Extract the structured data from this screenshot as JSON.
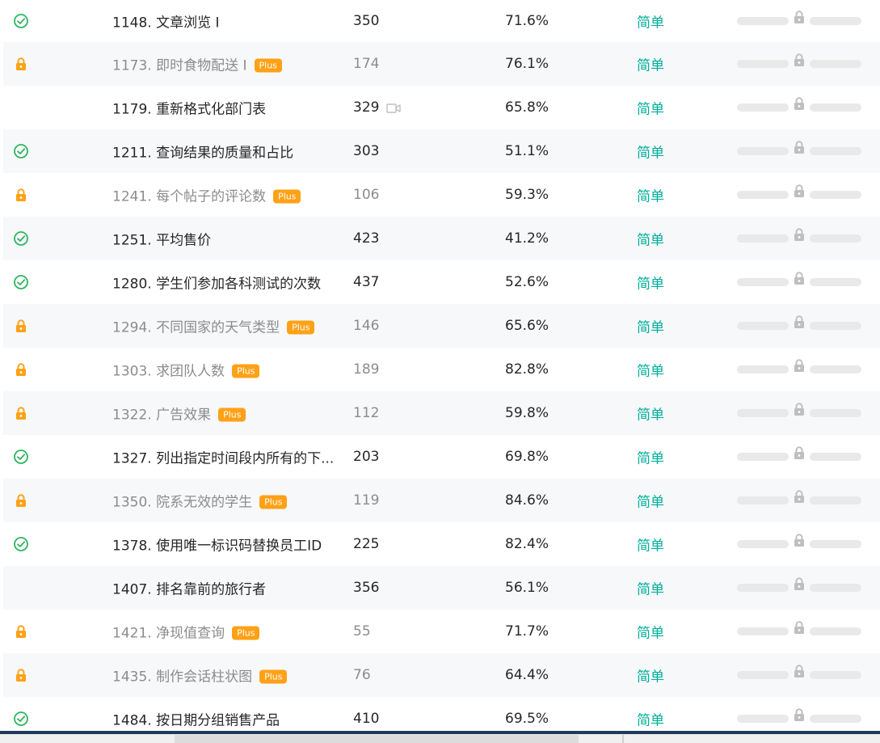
{
  "rows": [
    {
      "title": "1148. 文章浏览 I",
      "solutions": "350",
      "rate": "71.6%",
      "difficulty": "简单",
      "status": "solved",
      "plus": false,
      "video": false
    },
    {
      "title": "1173. 即时食物配送 I",
      "solutions": "174",
      "rate": "76.1%",
      "difficulty": "简单",
      "status": "locked",
      "plus": true,
      "video": false
    },
    {
      "title": "1179. 重新格式化部门表",
      "solutions": "329",
      "rate": "65.8%",
      "difficulty": "简单",
      "status": "none",
      "plus": false,
      "video": true
    },
    {
      "title": "1211. 查询结果的质量和占比",
      "solutions": "303",
      "rate": "51.1%",
      "difficulty": "简单",
      "status": "solved",
      "plus": false,
      "video": false
    },
    {
      "title": "1241. 每个帖子的评论数",
      "solutions": "106",
      "rate": "59.3%",
      "difficulty": "简单",
      "status": "locked",
      "plus": true,
      "video": false
    },
    {
      "title": "1251. 平均售价",
      "solutions": "423",
      "rate": "41.2%",
      "difficulty": "简单",
      "status": "solved",
      "plus": false,
      "video": false
    },
    {
      "title": "1280. 学生们参加各科测试的次数",
      "solutions": "437",
      "rate": "52.6%",
      "difficulty": "简单",
      "status": "solved",
      "plus": false,
      "video": false
    },
    {
      "title": "1294. 不同国家的天气类型",
      "solutions": "146",
      "rate": "65.6%",
      "difficulty": "简单",
      "status": "locked",
      "plus": true,
      "video": false
    },
    {
      "title": "1303. 求团队人数",
      "solutions": "189",
      "rate": "82.8%",
      "difficulty": "简单",
      "status": "locked",
      "plus": true,
      "video": false
    },
    {
      "title": "1322. 广告效果",
      "solutions": "112",
      "rate": "59.8%",
      "difficulty": "简单",
      "status": "locked",
      "plus": true,
      "video": false
    },
    {
      "title": "1327. 列出指定时间段内所有的下...",
      "solutions": "203",
      "rate": "69.8%",
      "difficulty": "简单",
      "status": "solved",
      "plus": false,
      "video": false
    },
    {
      "title": "1350. 院系无效的学生",
      "solutions": "119",
      "rate": "84.6%",
      "difficulty": "简单",
      "status": "locked",
      "plus": true,
      "video": false
    },
    {
      "title": "1378. 使用唯一标识码替换员工ID",
      "solutions": "225",
      "rate": "82.4%",
      "difficulty": "简单",
      "status": "solved",
      "plus": false,
      "video": false
    },
    {
      "title": "1407. 排名靠前的旅行者",
      "solutions": "356",
      "rate": "56.1%",
      "difficulty": "简单",
      "status": "none",
      "plus": false,
      "video": false
    },
    {
      "title": "1421. 净现值查询",
      "solutions": "55",
      "rate": "71.7%",
      "difficulty": "简单",
      "status": "locked",
      "plus": true,
      "video": false
    },
    {
      "title": "1435. 制作会话柱状图",
      "solutions": "76",
      "rate": "64.4%",
      "difficulty": "简单",
      "status": "locked",
      "plus": true,
      "video": false
    },
    {
      "title": "1484. 按日期分组销售产品",
      "solutions": "410",
      "rate": "69.5%",
      "difficulty": "简单",
      "status": "solved",
      "plus": false,
      "video": false
    }
  ],
  "plus_label": "Plus",
  "colors": {
    "solved": "#2db55d",
    "locked": "#ffa116",
    "easy": "#00af9b",
    "row_alt": "#f7f8fa",
    "bar": "#e9e9e9",
    "frequency_lock": "#bfbfbf"
  },
  "icons": {
    "solved": "check-circle-icon",
    "locked": "lock-icon",
    "video": "video-icon",
    "frequency": "frequency-lock-icon"
  }
}
